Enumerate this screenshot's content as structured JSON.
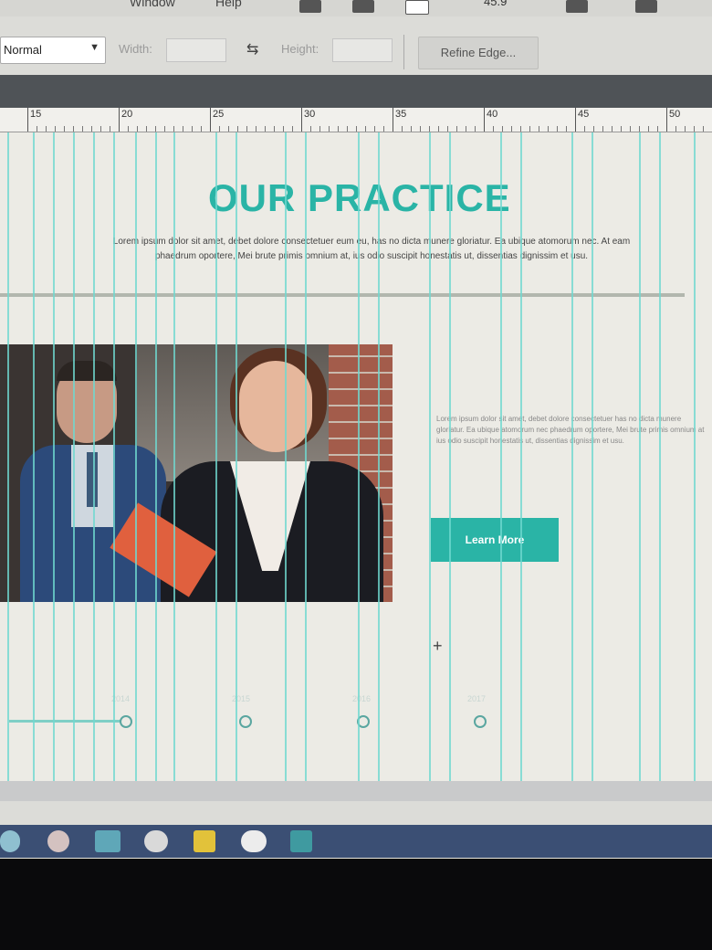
{
  "menubar": {
    "items": [
      "Window",
      "Help"
    ],
    "zoom_value": "45.9"
  },
  "options": {
    "mode": "Normal",
    "width_label": "Width:",
    "height_label": "Height:",
    "refine_label": "Refine Edge..."
  },
  "ruler": {
    "marks": [
      "15",
      "20",
      "25",
      "30",
      "35",
      "40",
      "45",
      "50"
    ]
  },
  "page": {
    "heading": "OUR PRACTICE",
    "intro": "Lorem ipsum dolor sit amet, debet dolore consectetuer eum eu, has no dicta munere gloriatur. Ea ubique atomorum nec. At eam phaedrum oportere, Mei brute primis omnium at, ius odio suscipit honestatis ut, dissentias dignissim et usu.",
    "side_text": "Lorem ipsum dolor sit amet, debet dolore consectetuer has no dicta munere gloriatur. Ea ubique atomorum nec phaedrum oportere, Mei brute primis omnium at ius odio suscipit honestatis ut, dissentias dignissim et usu.",
    "cta_label": "Learn More",
    "timeline": [
      "2014",
      "2015",
      "2016",
      "2017"
    ]
  },
  "colors": {
    "accent": "#2ab4a6",
    "guide": "#6fd8d0",
    "taskbar": "#3b4f74"
  }
}
